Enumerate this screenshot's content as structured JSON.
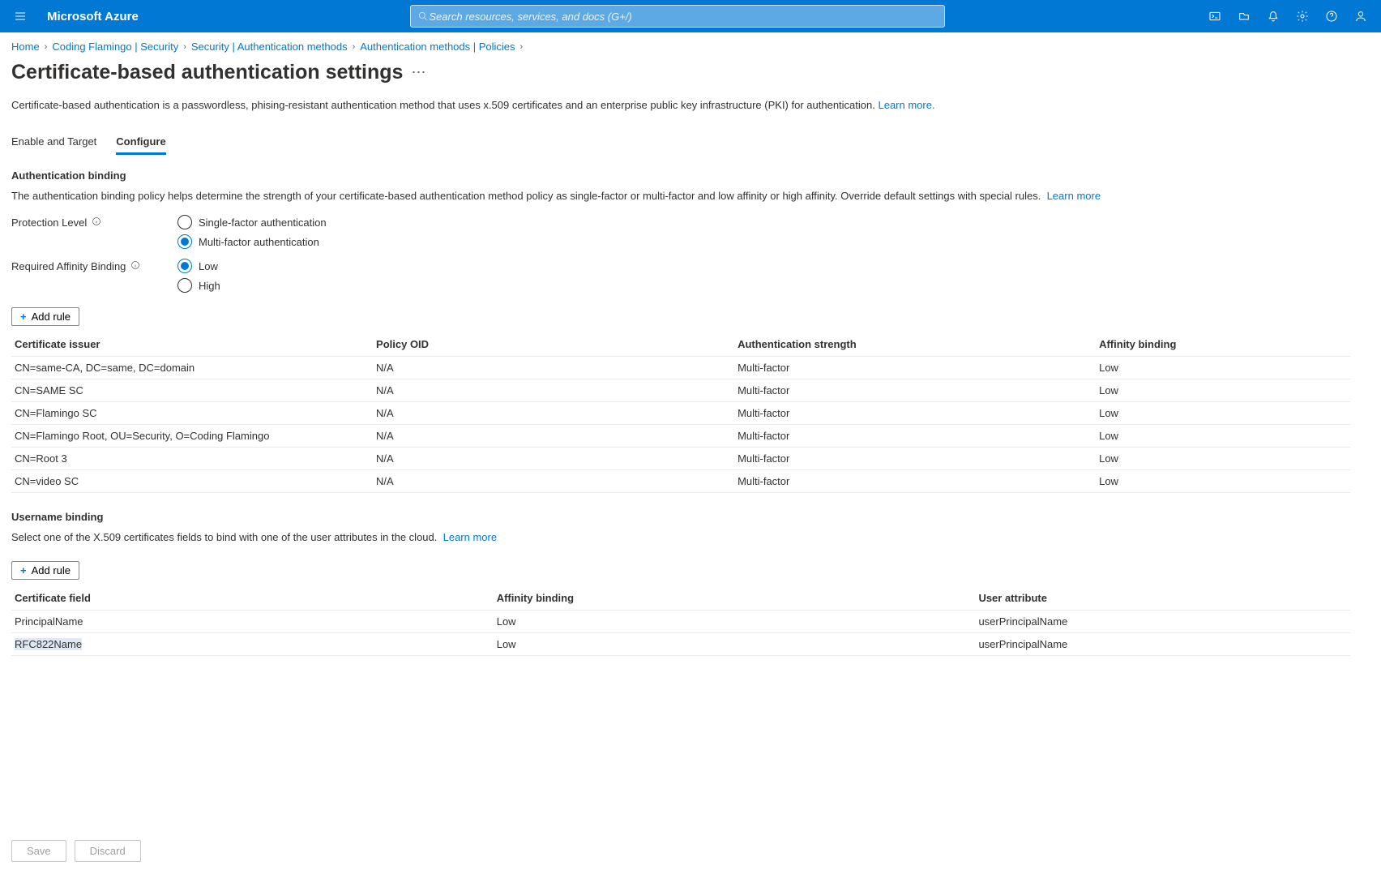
{
  "header": {
    "brand": "Microsoft Azure",
    "search_placeholder": "Search resources, services, and docs (G+/)"
  },
  "breadcrumb": [
    "Home",
    "Coding Flamingo | Security",
    "Security | Authentication methods",
    "Authentication methods | Policies"
  ],
  "page_title": "Certificate-based authentication settings",
  "intro": "Certificate-based authentication is a passwordless, phising-resistant authentication method that uses x.509 certificates and an enterprise public key infrastructure (PKI) for authentication.",
  "learn_more": "Learn more",
  "tabs": {
    "enable": "Enable and Target",
    "configure": "Configure"
  },
  "auth_binding": {
    "heading": "Authentication binding",
    "desc": "The authentication binding policy helps determine the strength of your certificate-based authentication method policy as single-factor or multi-factor and low affinity or high affinity. Override default settings with special rules.",
    "protection_label": "Protection Level",
    "single": "Single-factor authentication",
    "multi": "Multi-factor authentication",
    "affinity_label": "Required Affinity Binding",
    "low": "Low",
    "high": "High",
    "add_rule": "Add rule",
    "cols": {
      "issuer": "Certificate issuer",
      "oid": "Policy OID",
      "strength": "Authentication strength",
      "affinity": "Affinity binding"
    },
    "rows": [
      {
        "issuer": "CN=same-CA, DC=same, DC=domain",
        "oid": "N/A",
        "strength": "Multi-factor",
        "affinity": "Low"
      },
      {
        "issuer": "CN=SAME SC",
        "oid": "N/A",
        "strength": "Multi-factor",
        "affinity": "Low"
      },
      {
        "issuer": "CN=Flamingo SC",
        "oid": "N/A",
        "strength": "Multi-factor",
        "affinity": "Low"
      },
      {
        "issuer": "CN=Flamingo Root, OU=Security, O=Coding Flamingo",
        "oid": "N/A",
        "strength": "Multi-factor",
        "affinity": "Low"
      },
      {
        "issuer": "CN=Root 3",
        "oid": "N/A",
        "strength": "Multi-factor",
        "affinity": "Low"
      },
      {
        "issuer": "CN=video SC",
        "oid": "N/A",
        "strength": "Multi-factor",
        "affinity": "Low"
      }
    ]
  },
  "user_binding": {
    "heading": "Username binding",
    "desc": "Select one of the X.509 certificates fields to bind with one of the user attributes in the cloud.",
    "add_rule": "Add rule",
    "cols": {
      "field": "Certificate field",
      "affinity": "Affinity binding",
      "attr": "User attribute"
    },
    "rows": [
      {
        "field": "PrincipalName",
        "affinity": "Low",
        "attr": "userPrincipalName"
      },
      {
        "field": "RFC822Name",
        "affinity": "Low",
        "attr": "userPrincipalName"
      }
    ]
  },
  "footer": {
    "save": "Save",
    "discard": "Discard"
  }
}
